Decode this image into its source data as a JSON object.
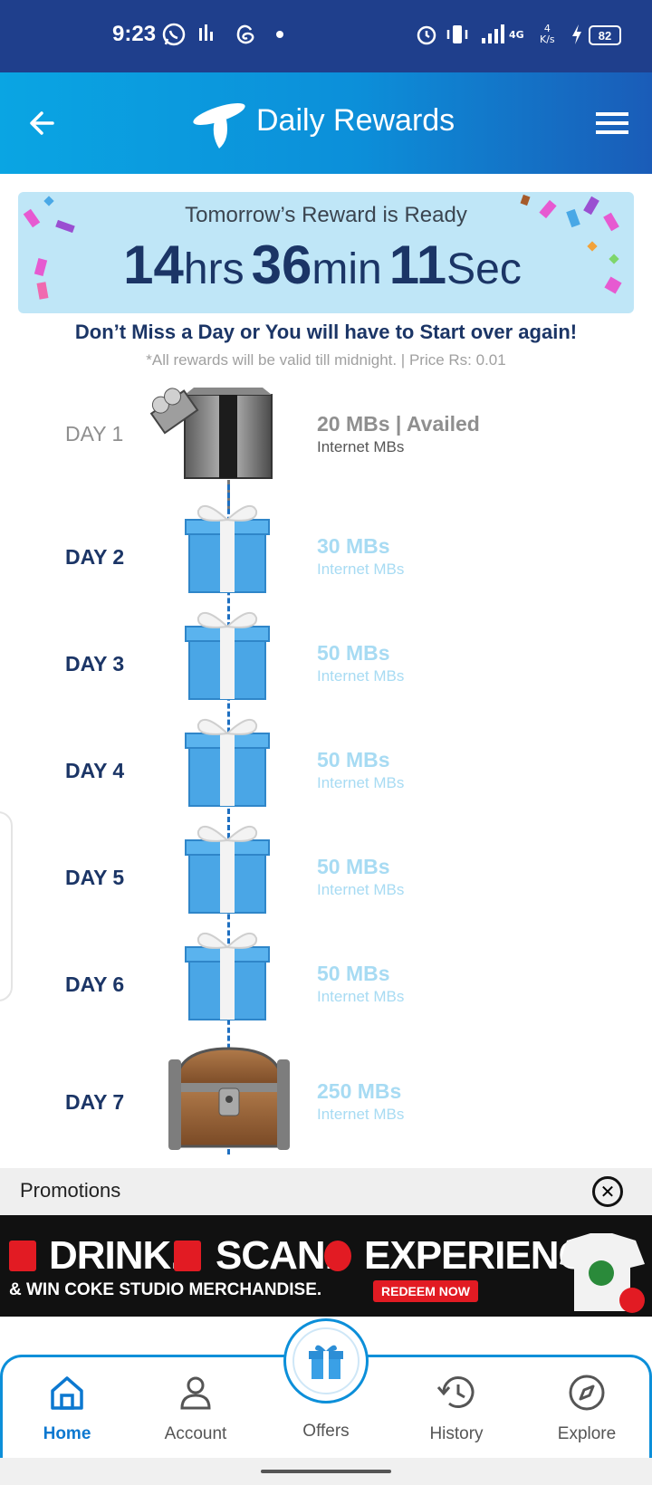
{
  "status_bar": {
    "time": "9:23",
    "network": "4G",
    "speed_top": "4",
    "speed_unit": "K/s",
    "battery": "82"
  },
  "app_bar": {
    "title": "Daily Rewards",
    "back_icon": "back-arrow-icon",
    "menu_icon": "hamburger-menu-icon",
    "logo_icon": "telenor-logo-icon"
  },
  "banner": {
    "heading": "Tomorrow’s Reward is Ready",
    "hours": "14",
    "hours_unit": "hrs",
    "minutes": "36",
    "minutes_unit": "min",
    "seconds": "11",
    "seconds_unit": "Sec"
  },
  "warning": "Don’t Miss a Day or You will have to Start over again!",
  "note": "*All rewards will be valid till midnight. | Price Rs: 0.01",
  "days": [
    {
      "label": "DAY 1",
      "reward": "20 MBs | Availed",
      "sub": "Internet MBs",
      "state": "availed",
      "icon": "open-gift-box-icon"
    },
    {
      "label": "DAY 2",
      "reward": "30 MBs",
      "sub": "Internet MBs",
      "state": "locked",
      "icon": "gift-box-icon"
    },
    {
      "label": "DAY 3",
      "reward": "50 MBs",
      "sub": "Internet MBs",
      "state": "locked",
      "icon": "gift-box-icon"
    },
    {
      "label": "DAY 4",
      "reward": "50 MBs",
      "sub": "Internet MBs",
      "state": "locked",
      "icon": "gift-box-icon"
    },
    {
      "label": "DAY 5",
      "reward": "50 MBs",
      "sub": "Internet MBs",
      "state": "locked",
      "icon": "gift-box-icon"
    },
    {
      "label": "DAY 6",
      "reward": "50 MBs",
      "sub": "Internet MBs",
      "state": "locked",
      "icon": "gift-box-icon"
    },
    {
      "label": "DAY 7",
      "reward": "250 MBs",
      "sub": "Internet MBs",
      "state": "locked",
      "icon": "treasure-chest-icon"
    }
  ],
  "promotions": {
    "label": "Promotions",
    "close_icon": "close-circle-icon"
  },
  "ad": {
    "word1": "DRINK.",
    "word2": "SCAN.",
    "word3": "EXPERIENCE.",
    "tagline": "& WIN COKE STUDIO MERCHANDISE.",
    "cta": "REDEEM NOW"
  },
  "bottom_nav": {
    "items": [
      {
        "label": "Home",
        "icon": "home-icon",
        "active": true
      },
      {
        "label": "Account",
        "icon": "person-icon",
        "active": false
      },
      {
        "label": "Offers",
        "icon": "gift-icon",
        "active": false
      },
      {
        "label": "History",
        "icon": "history-icon",
        "active": false
      },
      {
        "label": "Explore",
        "icon": "compass-icon",
        "active": false
      }
    ]
  },
  "colors": {
    "status_bar": "#1f3f8c",
    "app_bar_start": "#0aa5e3",
    "app_bar_end": "#1a5cb8",
    "navy_text": "#1b3566",
    "locked_text": "#a7dbf3",
    "gift_blue": "#4aa6e6"
  }
}
